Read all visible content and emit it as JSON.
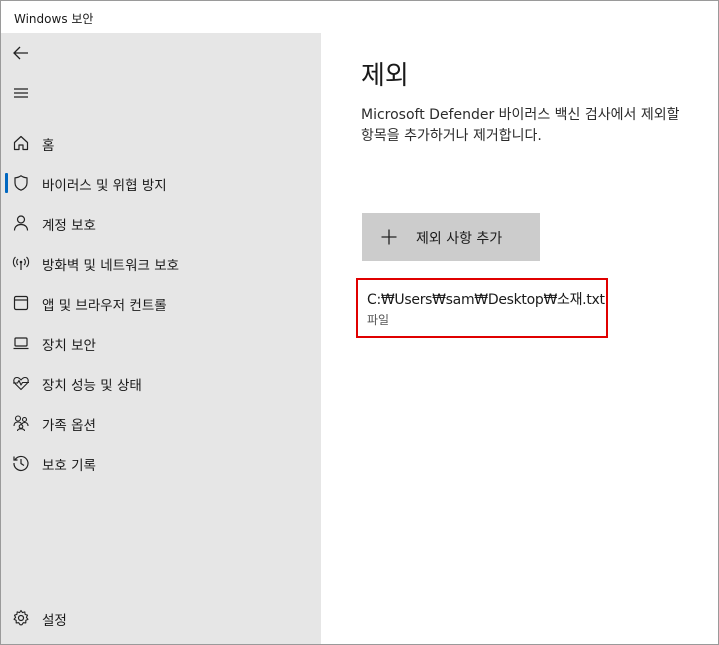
{
  "window": {
    "title": "Windows 보안"
  },
  "sidebar": {
    "items": [
      {
        "label": "홈",
        "icon": "home-icon"
      },
      {
        "label": "바이러스 및 위협 방지",
        "icon": "shield-icon",
        "selected": true
      },
      {
        "label": "계정 보호",
        "icon": "person-icon"
      },
      {
        "label": "방화벽 및 네트워크 보호",
        "icon": "network-icon"
      },
      {
        "label": "앱 및 브라우저 컨트롤",
        "icon": "app-window-icon"
      },
      {
        "label": "장치 보안",
        "icon": "laptop-icon"
      },
      {
        "label": "장치 성능 및 상태",
        "icon": "heart-pulse-icon"
      },
      {
        "label": "가족 옵션",
        "icon": "family-icon"
      },
      {
        "label": "보호 기록",
        "icon": "history-icon"
      }
    ],
    "settings_label": "설정"
  },
  "main": {
    "title": "제외",
    "description": "Microsoft Defender 바이러스 백신 검사에서 제외할 항목을 추가하거나 제거합니다.",
    "add_button_label": "제외 사항 추가",
    "exclusions": [
      {
        "path": "C:₩Users₩sam₩Desktop₩소재.txt",
        "type": "파일"
      }
    ]
  },
  "colors": {
    "accent": "#0067c0",
    "highlight_border": "#e00000",
    "sidebar_bg": "#e6e6e6",
    "button_bg": "#cccccc"
  }
}
